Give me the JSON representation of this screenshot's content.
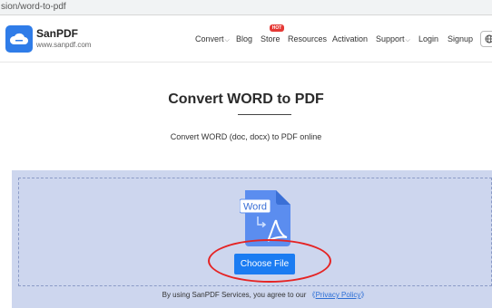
{
  "browser": {
    "url": "sion/word-to-pdf"
  },
  "header": {
    "brand": "SanPDF",
    "brand_url": "www.sanpdf.com",
    "nav": {
      "convert": "Convert",
      "blog": "Blog",
      "store": "Store",
      "store_badge": "HOT",
      "resources": "Resources",
      "activation": "Activation",
      "support": "Support",
      "login": "Login",
      "signup": "Signup"
    }
  },
  "main": {
    "title": "Convert WORD to PDF",
    "subtitle": "Convert WORD (doc, docx) to PDF online",
    "doc_label": "Word",
    "choose_file": "Choose File",
    "terms_prefix": "By using SanPDF Services, you agree to our",
    "terms_open": "《",
    "privacy_link": "Privacy Policy",
    "terms_close": "》"
  },
  "colors": {
    "accent": "#1b7cf2",
    "panel": "#cdd6ee",
    "highlight": "#e52424",
    "badge": "#e53935"
  },
  "icons": [
    "cloud-logo-icon",
    "chevron-down-icon",
    "globe-icon",
    "word-document-icon",
    "pdf-arrow-icon"
  ]
}
